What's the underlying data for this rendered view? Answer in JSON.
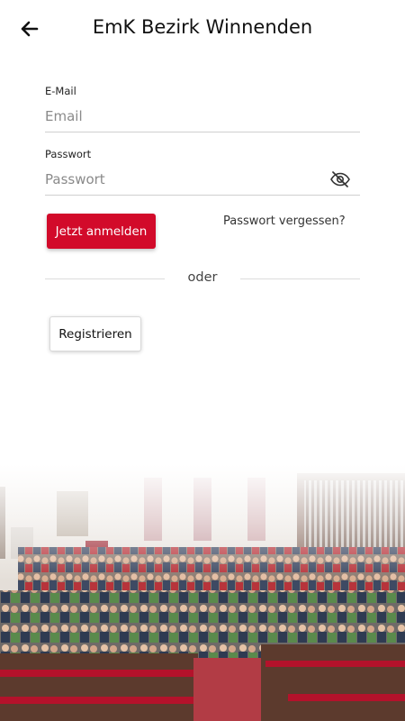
{
  "header": {
    "title": "EmK Bezirk Winnenden",
    "back_icon": "arrow-left-icon"
  },
  "form": {
    "email_label": "E-Mail",
    "email_placeholder": "Email",
    "email_value": "",
    "password_label": "Passwort",
    "password_placeholder": "Passwort",
    "password_value": "",
    "visibility_icon": "eye-off-icon"
  },
  "actions": {
    "login_label": "Jetzt anmelden",
    "forgot_label": "Passwort vergessen?",
    "divider_text": "oder",
    "register_label": "Registrieren"
  },
  "colors": {
    "accent": "#d20a2a"
  },
  "image": {
    "description_icon": "church-group-photo"
  }
}
